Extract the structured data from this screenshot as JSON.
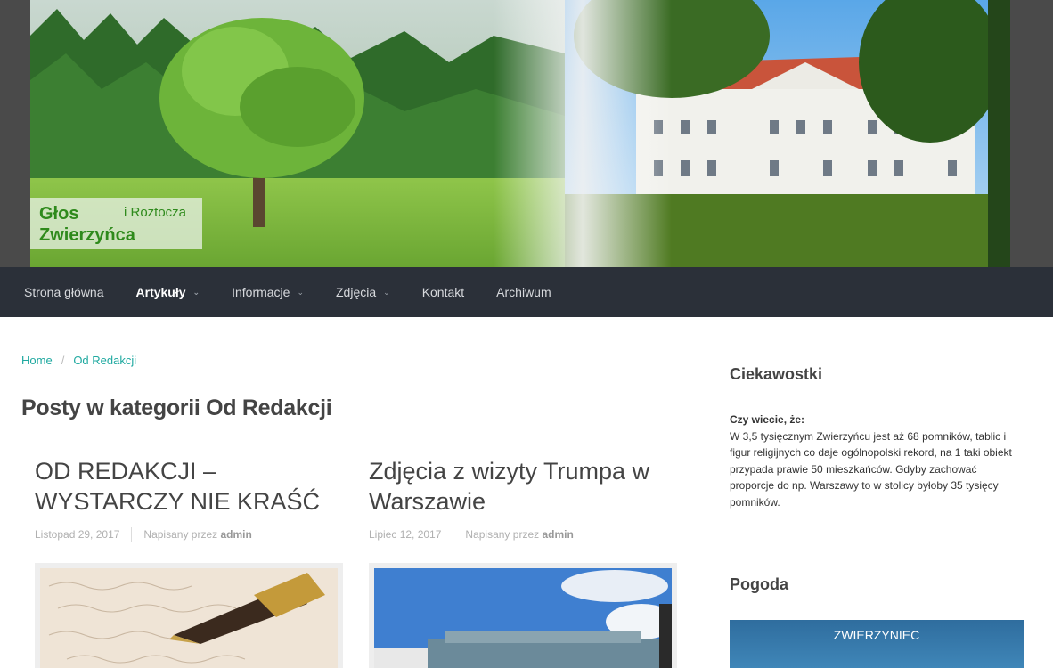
{
  "header": {
    "logo_main": "Głos\nZwierzyńca",
    "logo_sub": "i Roztocza"
  },
  "nav": {
    "items": [
      {
        "label": "Strona główna",
        "dropdown": false,
        "active": false
      },
      {
        "label": "Artykuły",
        "dropdown": true,
        "active": true
      },
      {
        "label": "Informacje",
        "dropdown": true,
        "active": false
      },
      {
        "label": "Zdjęcia",
        "dropdown": true,
        "active": false
      },
      {
        "label": "Kontakt",
        "dropdown": false,
        "active": false
      },
      {
        "label": "Archiwum",
        "dropdown": false,
        "active": false
      }
    ]
  },
  "breadcrumb": {
    "home": "Home",
    "current": "Od Redakcji"
  },
  "page_title": "Posty w kategorii Od Redakcji",
  "posts": [
    {
      "title": "OD REDAKCJI – WYSTARCZY NIE KRAŚĆ",
      "date": "Listopad 29, 2017",
      "by": "Napisany przez",
      "author": "admin",
      "thumb": "fountain-pen-letter"
    },
    {
      "title": "Zdjęcia z wizyty Trumpa w Warszawie",
      "date": "Lipiec 12, 2017",
      "by": "Napisany przez",
      "author": "admin",
      "thumb": "warsaw-visit-photo"
    }
  ],
  "sidebar": {
    "ciekawostki_title": "Ciekawostki",
    "ciekawostki_lead": "Czy wiecie, że:",
    "ciekawostki_text": "W 3,5 tysięcznym Zwierzyńcu jest aż 68 pomników, tablic i figur religijnych co daje ogólnopolski rekord, na 1 taki obiekt przypada prawie 50 mieszkańców. Gdyby zachować proporcje do np. Warszawy to w stolicy byłoby 35 tysięcy pomników.",
    "pogoda_title": "Pogoda",
    "weather_city": "ZWIERZYNIEC"
  },
  "colors": {
    "nav_bg": "#2b3039",
    "accent": "#1fa9a0",
    "logo_green": "#2f8a1c"
  }
}
